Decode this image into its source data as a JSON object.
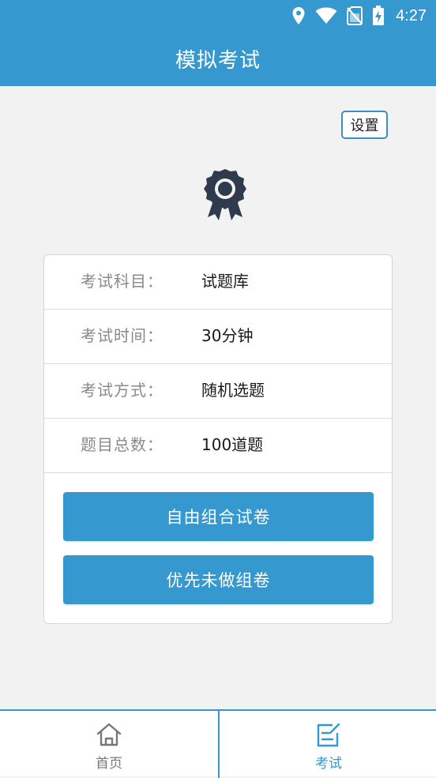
{
  "status_bar": {
    "time": "4:27",
    "icons": [
      "location-icon",
      "wifi-icon",
      "no-sim-icon",
      "battery-charging-icon"
    ]
  },
  "header": {
    "title": "模拟考试"
  },
  "toolbar": {
    "settings_label": "设置"
  },
  "badge": {
    "icon": "award-badge-icon"
  },
  "exam_info": {
    "rows": [
      {
        "label": "考试科目：",
        "value": "试题库"
      },
      {
        "label": "考试时间：",
        "value": "30分钟"
      },
      {
        "label": "考试方式：",
        "value": "随机选题"
      },
      {
        "label": "题目总数：",
        "value": "100道题"
      }
    ]
  },
  "actions": {
    "free_combo_label": "自由组合试卷",
    "unanswered_first_label": "优先未做组卷"
  },
  "bottom_nav": {
    "tabs": [
      {
        "label": "首页",
        "icon": "home-icon",
        "active": false
      },
      {
        "label": "考试",
        "icon": "exam-edit-icon",
        "active": true
      }
    ]
  },
  "colors": {
    "primary": "#3598cf",
    "badge": "#2f3b4c",
    "inactive": "#777777"
  }
}
